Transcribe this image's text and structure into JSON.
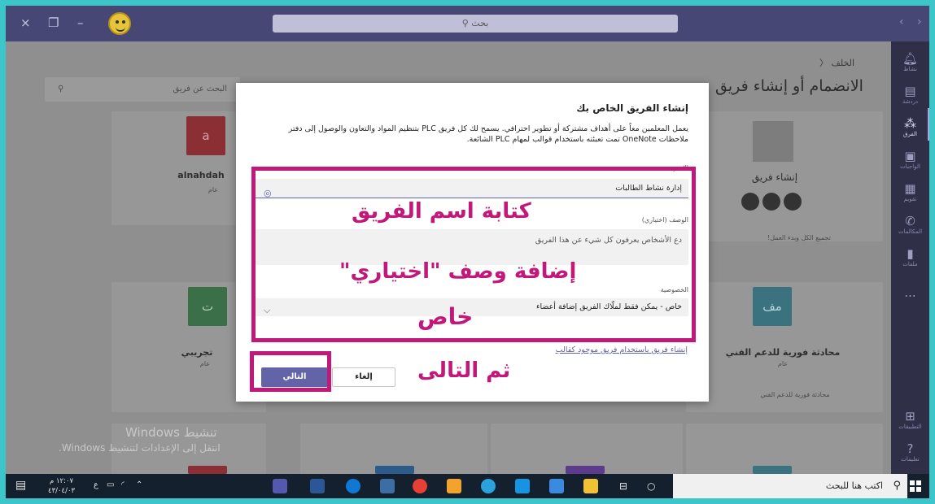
{
  "titlebar": {
    "search_placeholder": "بحث",
    "close_glyph": "×",
    "restore_glyph": "❐",
    "minimize_glyph": "–",
    "back_glyph": "‹",
    "forward_glyph": "›",
    "color": "#464775"
  },
  "rail": {
    "items": [
      {
        "label": "نشاط",
        "icon": "bell-icon"
      },
      {
        "label": "دردشة",
        "icon": "chat-icon"
      },
      {
        "label": "الفرق",
        "icon": "teams-icon"
      },
      {
        "label": "الواجبات",
        "icon": "assignments-icon"
      },
      {
        "label": "تقويم",
        "icon": "calendar-icon"
      },
      {
        "label": "المكالمات",
        "icon": "phone-icon"
      },
      {
        "label": "ملفات",
        "icon": "files-icon"
      },
      {
        "label": "...",
        "icon": "more-icon"
      },
      {
        "label": "التطبيقات",
        "icon": "apps-icon"
      },
      {
        "label": "تعليمات",
        "icon": "help-icon"
      }
    ]
  },
  "main": {
    "back_label": "الخلف",
    "heading": "الانضمام أو إنشاء فريق",
    "find_placeholder": "البحث عن فريق",
    "create_team_label": "إنشاء فريق",
    "create_team_hint": "تجميع الكل وبدء العمل!",
    "cards": [
      {
        "initial": "a",
        "name": "alnahdah",
        "type": "عام"
      },
      {
        "initial": "ت",
        "name": "تجريبي",
        "type": "عام"
      },
      {
        "initial": "مف",
        "name": "محادثة فورية للدعم الفني",
        "type": "عام",
        "desc": "محادثة فورية للدعم الفني"
      }
    ]
  },
  "watermark": {
    "line1": "تنشيط Windows",
    "line2": "انتقل إلى الإعدادات لتنشيط Windows."
  },
  "dialog": {
    "title": "إنشاء الفريق الخاص بك",
    "description": "يعمل المعلمين معاً على أهداف مشتركة أو تطوير احترافي. يسمح لك كل فريق PLC بتنظيم المواد والتعاون والوصول إلى دفتر ملاحظات OneNote تمت تعبئته باستخدام قوالب لمهام PLC الشائعة.",
    "name_label": "الاسم",
    "name_value": "إدارة نشاط الطالبات",
    "description_label": "الوصف (اختياري)",
    "description_placeholder": "دع الأشخاص يعرفون كل شيء عن هذا الفريق",
    "privacy_label": "الخصوصية",
    "privacy_value": "خاص - يمكن فقط لملّاك الفريق إضافة أعضاء",
    "template_link": "إنشاء فريق باستخدام فريق موجود كقالب",
    "next_button": "التالي",
    "cancel_button": "إلغاء",
    "accent": "#6264a7"
  },
  "annotations": {
    "write_name": "كتابة اسم الفريق",
    "add_description": "إضافة وصف \"اختياري\"",
    "private": "خاص",
    "then_next": "ثم التالى",
    "color": "#c2187a"
  },
  "taskbar": {
    "search_placeholder": "اكتب هنا للبحث",
    "clock_time": "١٢:٠٧ م",
    "clock_date": "٤٣/٠٤/٠٣",
    "lang": "ع"
  }
}
